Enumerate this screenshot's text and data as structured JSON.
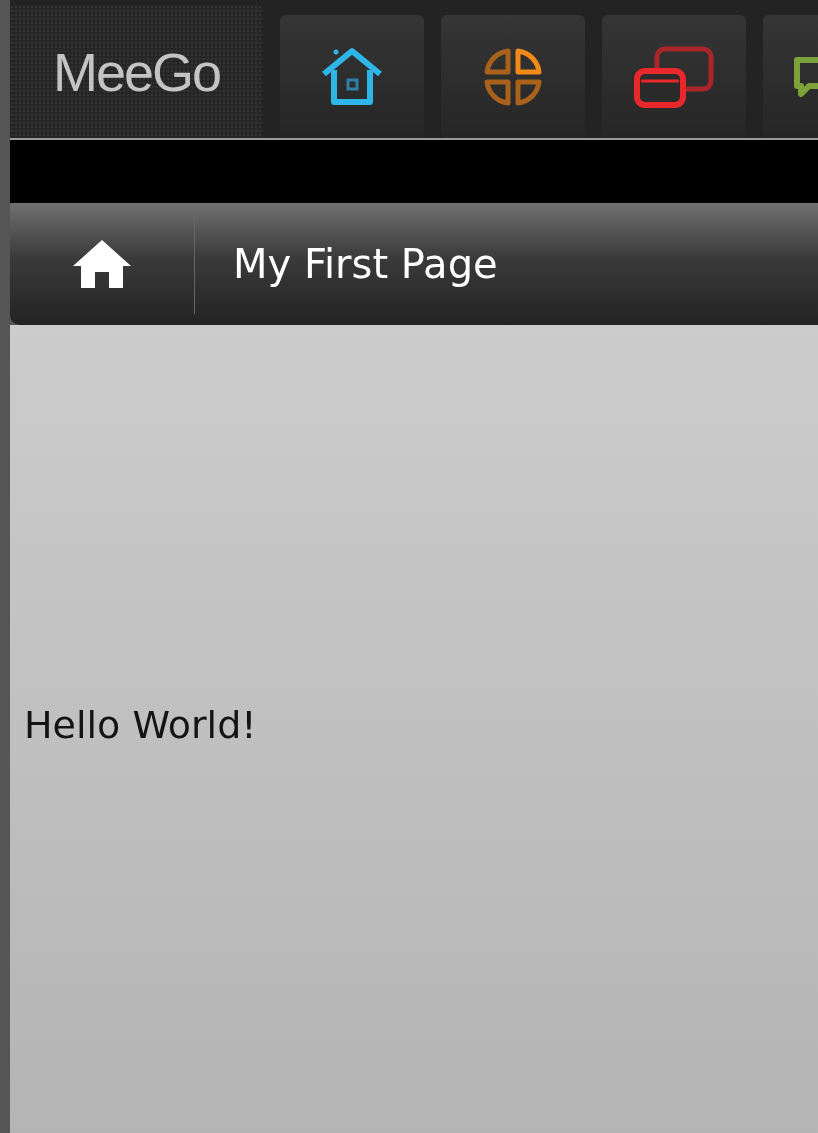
{
  "status_bar": {
    "logo": "MeeGo"
  },
  "toolbar": {
    "title": "My First Page"
  },
  "content": {
    "text": "Hello World!"
  }
}
